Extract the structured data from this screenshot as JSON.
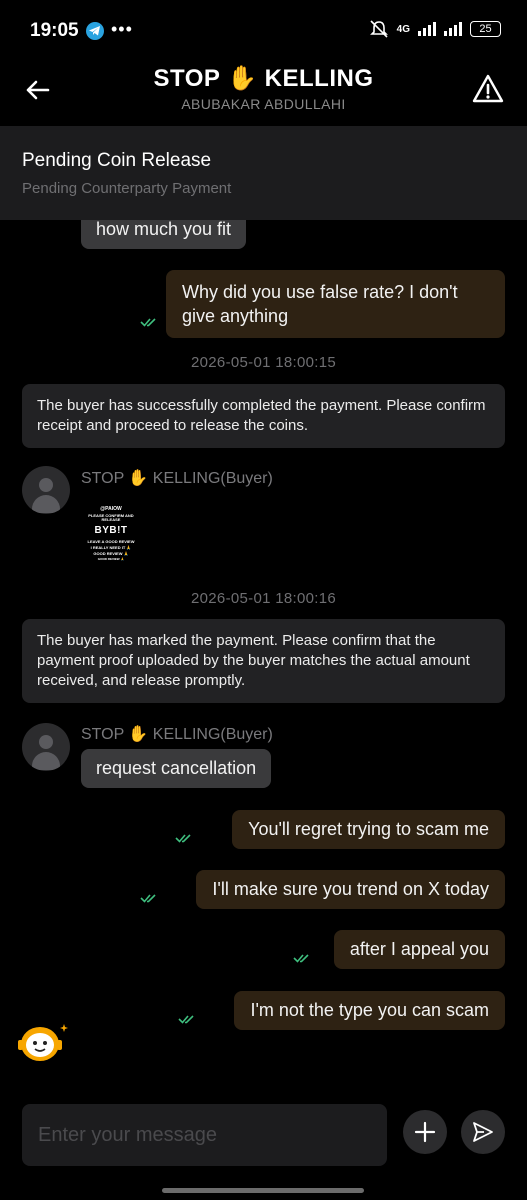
{
  "status_bar": {
    "time": "19:05",
    "dots": "•••",
    "network": "4G",
    "battery": "25"
  },
  "header": {
    "title": "STOP ✋ KELLING",
    "subtitle": "ABUBAKAR ABDULLAHI"
  },
  "order": {
    "status": "Pending Coin Release",
    "sub_status": "Pending Counterparty Payment"
  },
  "messages": [
    {
      "type": "incoming",
      "text": "how much you fit"
    },
    {
      "type": "outgoing",
      "text": "Why did you use false rate? I don't give anything",
      "read": true
    },
    {
      "type": "timestamp",
      "text": "2026-05-01 18:00:15"
    },
    {
      "type": "system",
      "text": "The buyer has successfully completed the payment. Please confirm receipt and proceed to release the coins."
    },
    {
      "type": "incoming_image",
      "sender": "STOP ✋ KELLING(Buyer)",
      "image_text": {
        "line1": "@PAIOW",
        "line2": "PLEASE CONFIRM AND RELEASE",
        "brand": "BYB!T",
        "line3": "LEAVE A GOOD REVIEW",
        "line4": "I REALLY NEED IT 🙏",
        "line5": "GOOD REVIEW 🙏",
        "line6": "GOOD REVIEW 🙏"
      }
    },
    {
      "type": "timestamp",
      "text": "2026-05-01 18:00:16"
    },
    {
      "type": "system",
      "text": "The buyer has marked the payment. Please confirm that the payment proof uploaded by the buyer matches the actual amount received, and release promptly."
    },
    {
      "type": "incoming",
      "sender": "STOP ✋ KELLING(Buyer)",
      "text": "request cancellation"
    },
    {
      "type": "outgoing",
      "text": "You'll regret trying to scam me",
      "read": true
    },
    {
      "type": "outgoing",
      "text": "I'll make sure you trend on X today",
      "read": true
    },
    {
      "type": "outgoing",
      "text": "after I appeal you",
      "read": true
    },
    {
      "type": "outgoing",
      "text": "I'm not the type you can scam",
      "read": true
    }
  ],
  "composer": {
    "placeholder": "Enter your message"
  },
  "colors": {
    "background": "#000000",
    "outgoing_bubble": "#2e2213",
    "incoming_bubble": "#3a3a3c",
    "system_bubble": "#222224",
    "read_check": "#3fbf7f",
    "accent": "#f7a600"
  }
}
